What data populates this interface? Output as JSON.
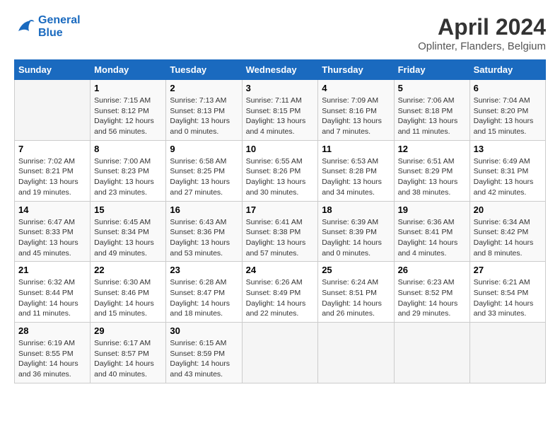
{
  "logo": {
    "line1": "General",
    "line2": "Blue"
  },
  "title": "April 2024",
  "subtitle": "Oplinter, Flanders, Belgium",
  "days_of_week": [
    "Sunday",
    "Monday",
    "Tuesday",
    "Wednesday",
    "Thursday",
    "Friday",
    "Saturday"
  ],
  "weeks": [
    [
      {
        "num": "",
        "info": ""
      },
      {
        "num": "1",
        "info": "Sunrise: 7:15 AM\nSunset: 8:12 PM\nDaylight: 12 hours\nand 56 minutes."
      },
      {
        "num": "2",
        "info": "Sunrise: 7:13 AM\nSunset: 8:13 PM\nDaylight: 13 hours\nand 0 minutes."
      },
      {
        "num": "3",
        "info": "Sunrise: 7:11 AM\nSunset: 8:15 PM\nDaylight: 13 hours\nand 4 minutes."
      },
      {
        "num": "4",
        "info": "Sunrise: 7:09 AM\nSunset: 8:16 PM\nDaylight: 13 hours\nand 7 minutes."
      },
      {
        "num": "5",
        "info": "Sunrise: 7:06 AM\nSunset: 8:18 PM\nDaylight: 13 hours\nand 11 minutes."
      },
      {
        "num": "6",
        "info": "Sunrise: 7:04 AM\nSunset: 8:20 PM\nDaylight: 13 hours\nand 15 minutes."
      }
    ],
    [
      {
        "num": "7",
        "info": "Sunrise: 7:02 AM\nSunset: 8:21 PM\nDaylight: 13 hours\nand 19 minutes."
      },
      {
        "num": "8",
        "info": "Sunrise: 7:00 AM\nSunset: 8:23 PM\nDaylight: 13 hours\nand 23 minutes."
      },
      {
        "num": "9",
        "info": "Sunrise: 6:58 AM\nSunset: 8:25 PM\nDaylight: 13 hours\nand 27 minutes."
      },
      {
        "num": "10",
        "info": "Sunrise: 6:55 AM\nSunset: 8:26 PM\nDaylight: 13 hours\nand 30 minutes."
      },
      {
        "num": "11",
        "info": "Sunrise: 6:53 AM\nSunset: 8:28 PM\nDaylight: 13 hours\nand 34 minutes."
      },
      {
        "num": "12",
        "info": "Sunrise: 6:51 AM\nSunset: 8:29 PM\nDaylight: 13 hours\nand 38 minutes."
      },
      {
        "num": "13",
        "info": "Sunrise: 6:49 AM\nSunset: 8:31 PM\nDaylight: 13 hours\nand 42 minutes."
      }
    ],
    [
      {
        "num": "14",
        "info": "Sunrise: 6:47 AM\nSunset: 8:33 PM\nDaylight: 13 hours\nand 45 minutes."
      },
      {
        "num": "15",
        "info": "Sunrise: 6:45 AM\nSunset: 8:34 PM\nDaylight: 13 hours\nand 49 minutes."
      },
      {
        "num": "16",
        "info": "Sunrise: 6:43 AM\nSunset: 8:36 PM\nDaylight: 13 hours\nand 53 minutes."
      },
      {
        "num": "17",
        "info": "Sunrise: 6:41 AM\nSunset: 8:38 PM\nDaylight: 13 hours\nand 57 minutes."
      },
      {
        "num": "18",
        "info": "Sunrise: 6:39 AM\nSunset: 8:39 PM\nDaylight: 14 hours\nand 0 minutes."
      },
      {
        "num": "19",
        "info": "Sunrise: 6:36 AM\nSunset: 8:41 PM\nDaylight: 14 hours\nand 4 minutes."
      },
      {
        "num": "20",
        "info": "Sunrise: 6:34 AM\nSunset: 8:42 PM\nDaylight: 14 hours\nand 8 minutes."
      }
    ],
    [
      {
        "num": "21",
        "info": "Sunrise: 6:32 AM\nSunset: 8:44 PM\nDaylight: 14 hours\nand 11 minutes."
      },
      {
        "num": "22",
        "info": "Sunrise: 6:30 AM\nSunset: 8:46 PM\nDaylight: 14 hours\nand 15 minutes."
      },
      {
        "num": "23",
        "info": "Sunrise: 6:28 AM\nSunset: 8:47 PM\nDaylight: 14 hours\nand 18 minutes."
      },
      {
        "num": "24",
        "info": "Sunrise: 6:26 AM\nSunset: 8:49 PM\nDaylight: 14 hours\nand 22 minutes."
      },
      {
        "num": "25",
        "info": "Sunrise: 6:24 AM\nSunset: 8:51 PM\nDaylight: 14 hours\nand 26 minutes."
      },
      {
        "num": "26",
        "info": "Sunrise: 6:23 AM\nSunset: 8:52 PM\nDaylight: 14 hours\nand 29 minutes."
      },
      {
        "num": "27",
        "info": "Sunrise: 6:21 AM\nSunset: 8:54 PM\nDaylight: 14 hours\nand 33 minutes."
      }
    ],
    [
      {
        "num": "28",
        "info": "Sunrise: 6:19 AM\nSunset: 8:55 PM\nDaylight: 14 hours\nand 36 minutes."
      },
      {
        "num": "29",
        "info": "Sunrise: 6:17 AM\nSunset: 8:57 PM\nDaylight: 14 hours\nand 40 minutes."
      },
      {
        "num": "30",
        "info": "Sunrise: 6:15 AM\nSunset: 8:59 PM\nDaylight: 14 hours\nand 43 minutes."
      },
      {
        "num": "",
        "info": ""
      },
      {
        "num": "",
        "info": ""
      },
      {
        "num": "",
        "info": ""
      },
      {
        "num": "",
        "info": ""
      }
    ]
  ]
}
